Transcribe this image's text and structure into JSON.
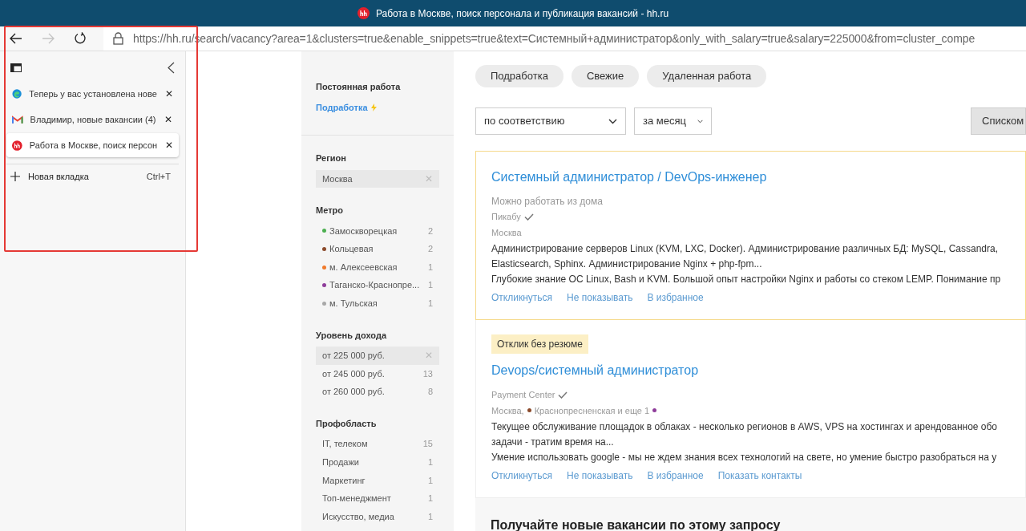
{
  "window": {
    "title": "Работа в Москве, поиск персонала и публикация вакансий - hh.ru"
  },
  "toolbar": {
    "url": "https://hh.ru/search/vacancy?area=1&clusters=true&enable_snippets=true&text=Системный+администратор&only_with_salary=true&salary=225000&from=cluster_compe",
    "forward_disabled": true
  },
  "tabs": [
    {
      "kind": "edge",
      "title": "Теперь у вас установлена нове",
      "close": "✕",
      "selected": false
    },
    {
      "kind": "gmail",
      "title": "Владимир, новые вакансии (4)",
      "close": "✕",
      "selected": false
    },
    {
      "kind": "hh",
      "title": "Работа в Москве, поиск персон",
      "close": "✕",
      "selected": true
    }
  ],
  "new_tab": {
    "label": "Новая вкладка",
    "shortcut": "Ctrl+T"
  },
  "employment": {
    "current": "Постоянная работа",
    "link": "Подработка"
  },
  "filters": [
    {
      "title": "Регион",
      "items": [
        {
          "label": "Москва",
          "remove": "✕",
          "selected": true
        }
      ]
    },
    {
      "title": "Метро",
      "items": [
        {
          "label": "Замоскворецкая",
          "count": "2",
          "color": "#4caf50",
          "selected": false
        },
        {
          "label": "Кольцевая",
          "count": "2",
          "color": "#8b4a2b",
          "selected": false
        },
        {
          "label": "м. Алексеевская",
          "count": "1",
          "color": "#f07a2b",
          "selected": false
        },
        {
          "label": "Таганско-Краснопре...",
          "count": "1",
          "color": "#8e3d9a",
          "selected": false
        },
        {
          "label": "м. Тульская",
          "count": "1",
          "color": "#a8a8a8",
          "selected": false
        }
      ]
    },
    {
      "title": "Уровень дохода",
      "items": [
        {
          "label": "от 225 000 руб.",
          "remove": "✕",
          "selected": true
        },
        {
          "label": "от 245 000 руб.",
          "count": "13",
          "selected": false
        },
        {
          "label": "от 260 000 руб.",
          "count": "8",
          "selected": false
        }
      ]
    },
    {
      "title": "Профобласть",
      "items": [
        {
          "label": "IT, телеком",
          "count": "15",
          "selected": false
        },
        {
          "label": "Продажи",
          "count": "1",
          "selected": false
        },
        {
          "label": "Маркетинг",
          "count": "1",
          "selected": false
        },
        {
          "label": "Топ-менеджмент",
          "count": "1",
          "selected": false
        },
        {
          "label": "Искусство, медиа",
          "count": "1",
          "selected": false
        }
      ]
    }
  ],
  "chips": [
    "Подработка",
    "Свежие",
    "Удаленная работа"
  ],
  "sort": {
    "order": "по соответствию",
    "period": "за месяц",
    "view_button": "Списком"
  },
  "vacancies": [
    {
      "highlighted": true,
      "title": "Системный администратор / DevOps-инженер",
      "remote": "Можно работать из дома",
      "company": "Пикабу",
      "location": [
        {
          "text": "Москва"
        }
      ],
      "snippet": [
        "Администрирование серверов Linux (KVM, LXC, Docker). Администрирование различных БД: MySQL, Cassandra,",
        "Elasticsearch, Sphinx. Администрирование Nginx + php-fpm...",
        "Глубокие знание ОС Linux, Bash и KVM. Большой опыт настройки Nginx и работы со стеком LEMP. Понимание пр"
      ],
      "actions": [
        "Откликнуться",
        "Не показывать",
        "В избранное"
      ]
    },
    {
      "highlighted": false,
      "badge": "Отклик без резюме",
      "title": "Devops/системный администратор",
      "company": "Payment Center",
      "location": [
        {
          "text": "Москва,"
        },
        {
          "text": "Краснопресненская и еще 1",
          "color": "#8b4a2b",
          "extra": {
            "color": "#8e3d9a"
          }
        }
      ],
      "snippet": [
        "Текущее обслуживание площадок в облаках - несколько регионов в AWS, VPS на хостингах и арендованное обо",
        "задачи - тратим время на...",
        "Умение использовать google - мы не ждем знания всех технологий на свете, но умение быстро разобраться на у"
      ],
      "actions": [
        "Откликнуться",
        "Не показывать",
        "В избранное",
        "Показать контакты"
      ]
    }
  ],
  "subscribe": {
    "title": "Получайте новые вакансии по этому запросу"
  }
}
